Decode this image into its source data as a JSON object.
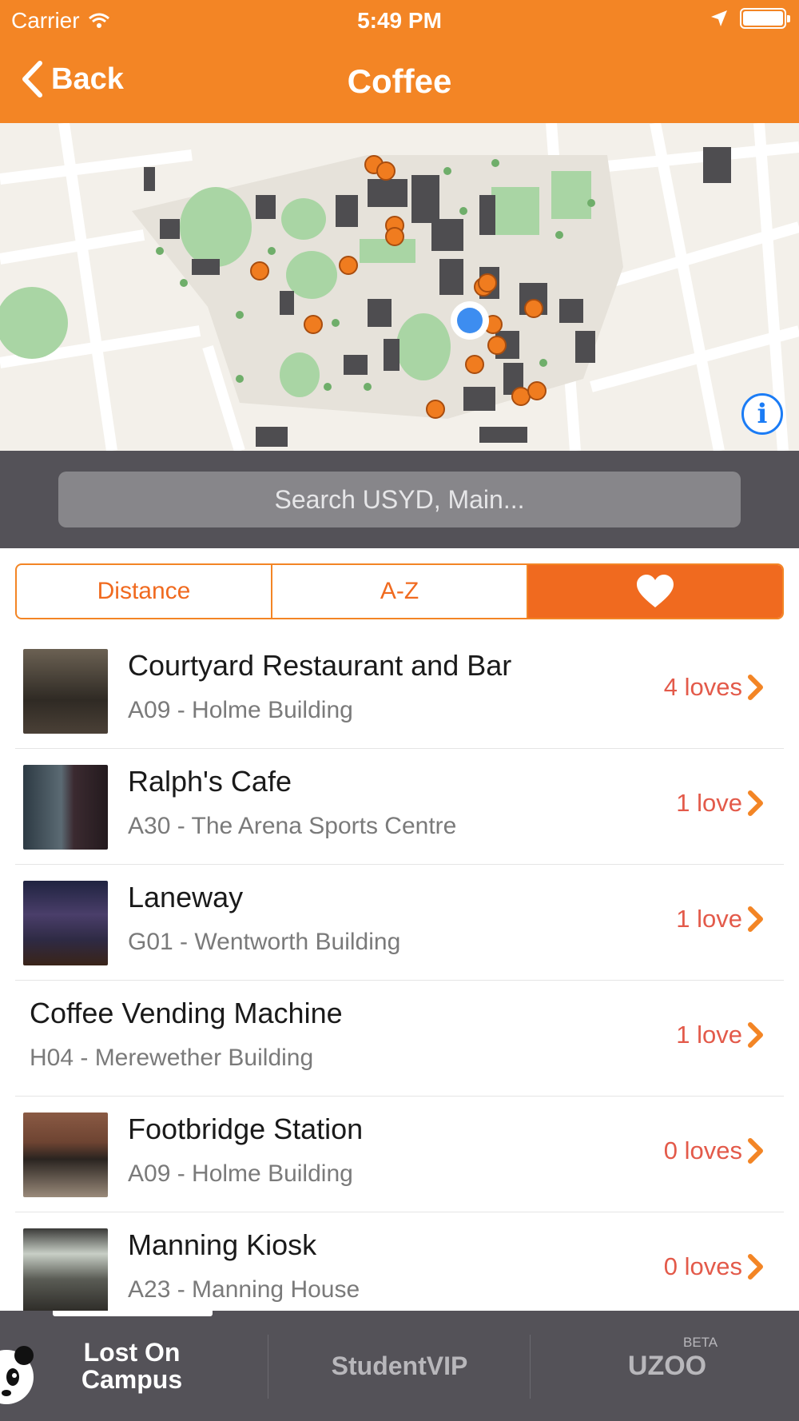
{
  "status": {
    "carrier": "Carrier",
    "time": "5:49 PM"
  },
  "nav": {
    "back_label": "Back",
    "title": "Coffee"
  },
  "map": {
    "info_icon": "i"
  },
  "search": {
    "placeholder": "Search USYD, Main..."
  },
  "segments": {
    "distance": "Distance",
    "az": "A-Z",
    "favorites_icon": "heart-icon",
    "active": "favorites"
  },
  "list": [
    {
      "title": "Courtyard Restaurant and Bar",
      "subtitle": "A09 - Holme Building",
      "loves": "4 loves",
      "thumb_color": "#4a4036"
    },
    {
      "title": "Ralph's Cafe",
      "subtitle": "A30 - The Arena Sports Centre",
      "loves": "1 love",
      "thumb_color": "#3b2a30"
    },
    {
      "title": "Laneway",
      "subtitle": "G01 - Wentworth Building",
      "loves": "1 love",
      "thumb_color": "#2e2a44"
    },
    {
      "title": "Coffee Vending Machine",
      "subtitle": "H04 - Merewether Building",
      "loves": "1 love"
    },
    {
      "title": "Footbridge Station",
      "subtitle": "A09 - Holme Building",
      "loves": "0 loves",
      "thumb_color": "#6e4432"
    },
    {
      "title": "Manning Kiosk",
      "subtitle": "A23 - Manning House",
      "loves": "0 loves",
      "thumb_color": "#5a5c55"
    }
  ],
  "tabbar": {
    "tab1_line1": "Lost On",
    "tab1_line2": "Campus",
    "tab2": "StudentVIP",
    "tab3": "UZOO",
    "tab3_badge": "BETA"
  },
  "colors": {
    "brand": "#f38525",
    "accent": "#f06a1f",
    "loves": "#e35a4a",
    "location": "#3d8df0"
  }
}
